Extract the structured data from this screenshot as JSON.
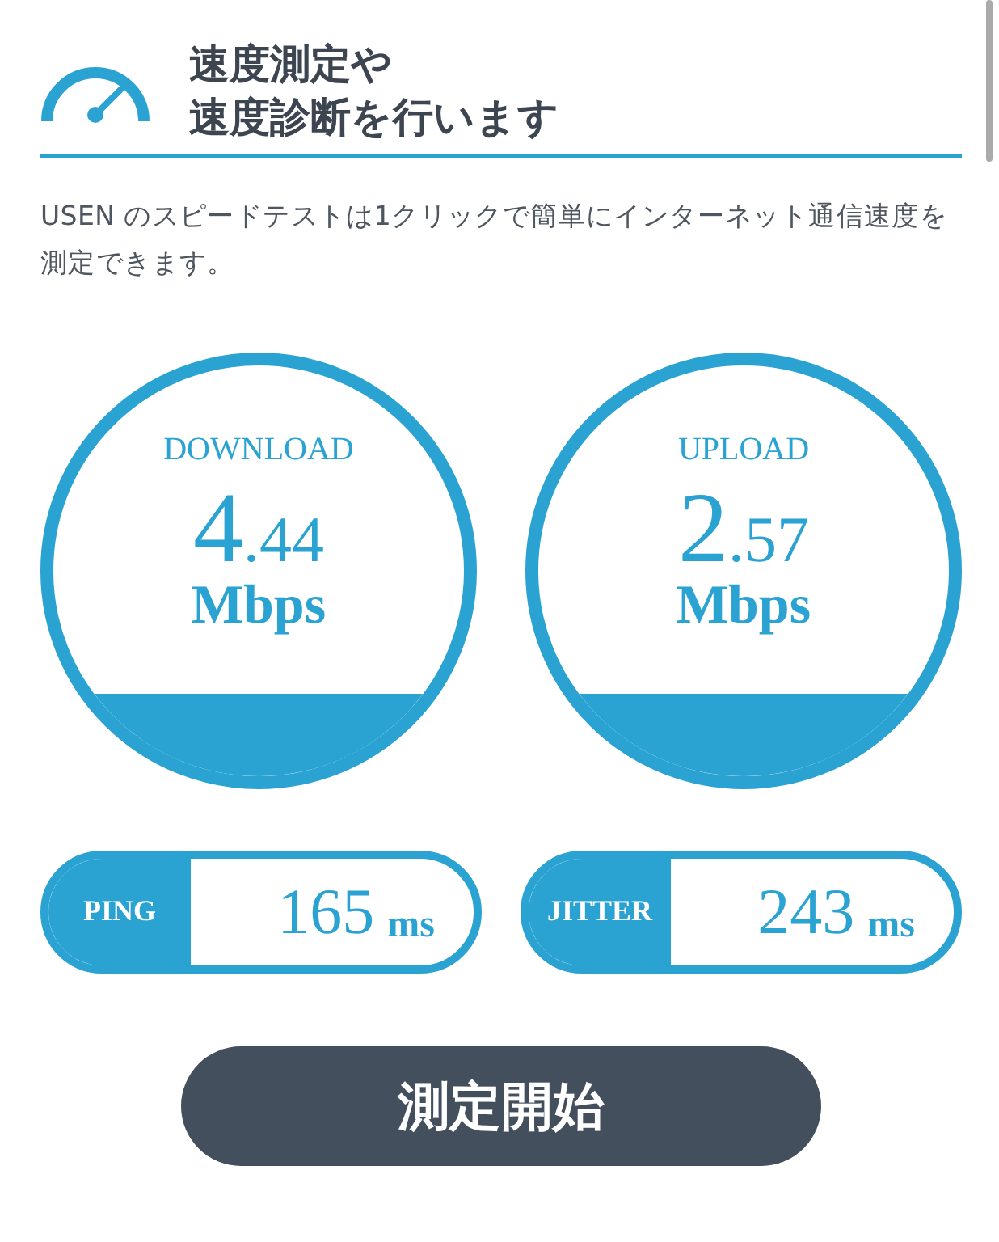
{
  "header": {
    "title_lines": [
      "速度測定や",
      "速度診断を行います"
    ]
  },
  "intro": "USEN のスピードテストは1クリックで簡単にインターネット通信速度を測定できます。",
  "gauges": [
    {
      "label": "DOWNLOAD",
      "value": "4.44",
      "unit": "Mbps"
    },
    {
      "label": "UPLOAD",
      "value": "2.57",
      "unit": "Mbps"
    }
  ],
  "latency": [
    {
      "label": "PING",
      "value": "165",
      "unit": "ms"
    },
    {
      "label": "JITTER",
      "value": "243",
      "unit": "ms"
    }
  ],
  "start_button": "測定開始"
}
